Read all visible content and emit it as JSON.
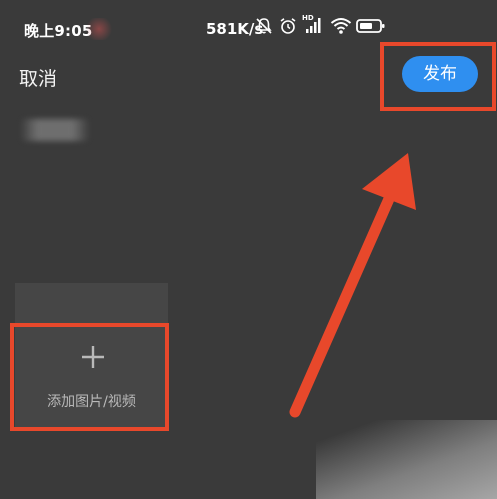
{
  "status_bar": {
    "time": "晚上9:05",
    "network_speed": "581K/s",
    "hd_label": "HD",
    "icons": [
      "mute-bell-icon",
      "alarm-icon",
      "signal-icon",
      "wifi-icon",
      "battery-icon"
    ]
  },
  "header": {
    "cancel_label": "取消",
    "publish_label": "发布"
  },
  "media": {
    "add_icon": "plus-icon",
    "add_label": "添加图片/视频"
  },
  "colors": {
    "background": "#3a3a3a",
    "publish_button": "#2f8ff0",
    "annotation_red": "#e8482b"
  }
}
